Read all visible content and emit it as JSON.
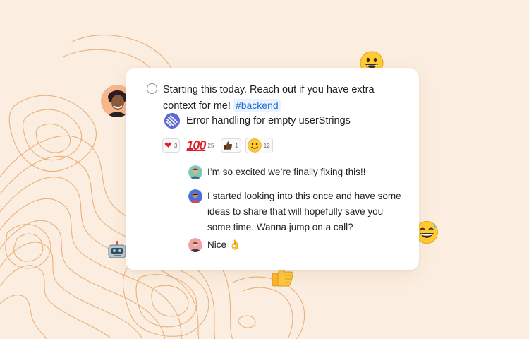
{
  "task": {
    "text": "Starting this today. Reach out if you have extra context for me!",
    "tag": "#backend"
  },
  "issue": {
    "title": "Error handling for empty userStrings"
  },
  "reactions": [
    {
      "emoji": "heart",
      "glyph": "❤",
      "count": "3"
    },
    {
      "emoji": "hundred",
      "glyph": "100",
      "count": "25"
    },
    {
      "emoji": "thumbs-up-dark",
      "glyph": "👍",
      "count": "1"
    },
    {
      "emoji": "smiley",
      "glyph": "🙂",
      "count": "12"
    }
  ],
  "comments": [
    {
      "text": "I’m so excited we’re finally fixing this!!"
    },
    {
      "text": "I started looking into this once and have some ideas to share that will hopefully save you some time. Wanna jump on a call?"
    },
    {
      "text": "Nice 👌"
    }
  ],
  "colors": {
    "background": "#fbeee0",
    "contour": "#e8a66a",
    "accent_blue": "#1f6fd1",
    "linear_purple": "#5e6ad2"
  },
  "decor": {
    "emojis": [
      "grinning-face-icon",
      "sweat-smile-icon",
      "thumbs-up-icon",
      "robot-icon"
    ]
  }
}
